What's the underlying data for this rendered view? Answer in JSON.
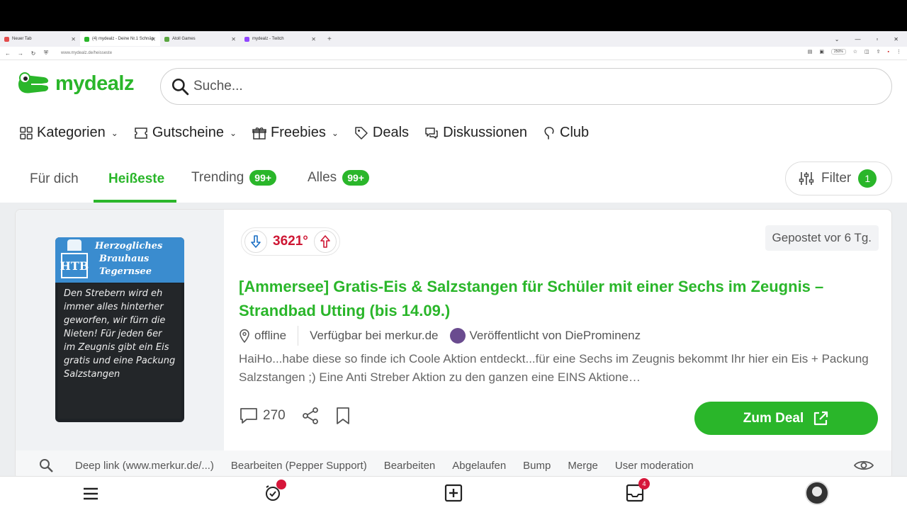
{
  "browser": {
    "tabs": [
      {
        "title": "Neuer Tab",
        "color": "#e34c4c"
      },
      {
        "title": "(4) mydealz - Deine Nr.1 Schnäp",
        "color": "#2ab62a"
      },
      {
        "title": "Atoll Games",
        "color": "#5aa640"
      },
      {
        "title": "mydealz - Twitch",
        "color": "#9146ff"
      }
    ],
    "url": "www.mydealz.de/heisseste",
    "zoom": "250%"
  },
  "header": {
    "logo_text": "mydealz",
    "search_placeholder": "Suche..."
  },
  "catnav": [
    {
      "label": "Kategorien",
      "icon": "grid-icon",
      "dropdown": true
    },
    {
      "label": "Gutscheine",
      "icon": "ticket-icon",
      "dropdown": true
    },
    {
      "label": "Freebies",
      "icon": "gift-icon",
      "dropdown": true
    },
    {
      "label": "Deals",
      "icon": "tag-icon",
      "dropdown": false
    },
    {
      "label": "Diskussionen",
      "icon": "chat-icon",
      "dropdown": false
    },
    {
      "label": "Club",
      "icon": "club-icon",
      "dropdown": false
    }
  ],
  "feed_tabs": {
    "fuer_dich": "Für dich",
    "heisseste": "Heißeste",
    "trending": "Trending",
    "trending_badge": "99+",
    "alles": "Alles",
    "alles_badge": "99+",
    "filter": "Filter",
    "filter_count": "1"
  },
  "deal": {
    "temperature": "3621°",
    "posted": "Gepostet vor 6 Tg.",
    "title": "[Ammersee] Gratis-Eis & Salzstangen für Schüler mit einer Sechs im Zeugnis – Strandbad Utting (bis 14.09.)",
    "location": "offline",
    "available": "Verfügbar bei merkur.de",
    "author": "Veröffentlicht von DieProminenz",
    "description": "HaiHo...habe diese so finde ich Coole Aktion entdeckt...für eine Sechs im Zeugnis bekommt Ihr hier ein Eis + Packung Salzstangen ;) Eine Anti Streber Aktion zu den ganzen eine EINS Aktione…",
    "comments": "270",
    "cta": "Zum Deal",
    "image": {
      "banner_line1": "Herzogliches",
      "banner_line2": "Brauhaus",
      "banner_line3": "Tegernsee",
      "banner_mark": "HTB",
      "board_text": "Den Strebern wird eh immer alles hinterher geworfen, wir fürn die Nieten! Für jeden 6er im Zeugnis gibt ein Eis gratis und eine Packung Salzstangen"
    }
  },
  "moderation": {
    "items": [
      "Deep link (www.merkur.de/...)",
      "Bearbeiten (Pepper Support)",
      "Bearbeiten",
      "Abgelaufen",
      "Bump",
      "Merge",
      "User moderation"
    ]
  },
  "bottombar": {
    "notifications_badge": "4"
  },
  "colors": {
    "brand_green": "#2ab62a",
    "hot_red": "#ce1734"
  }
}
